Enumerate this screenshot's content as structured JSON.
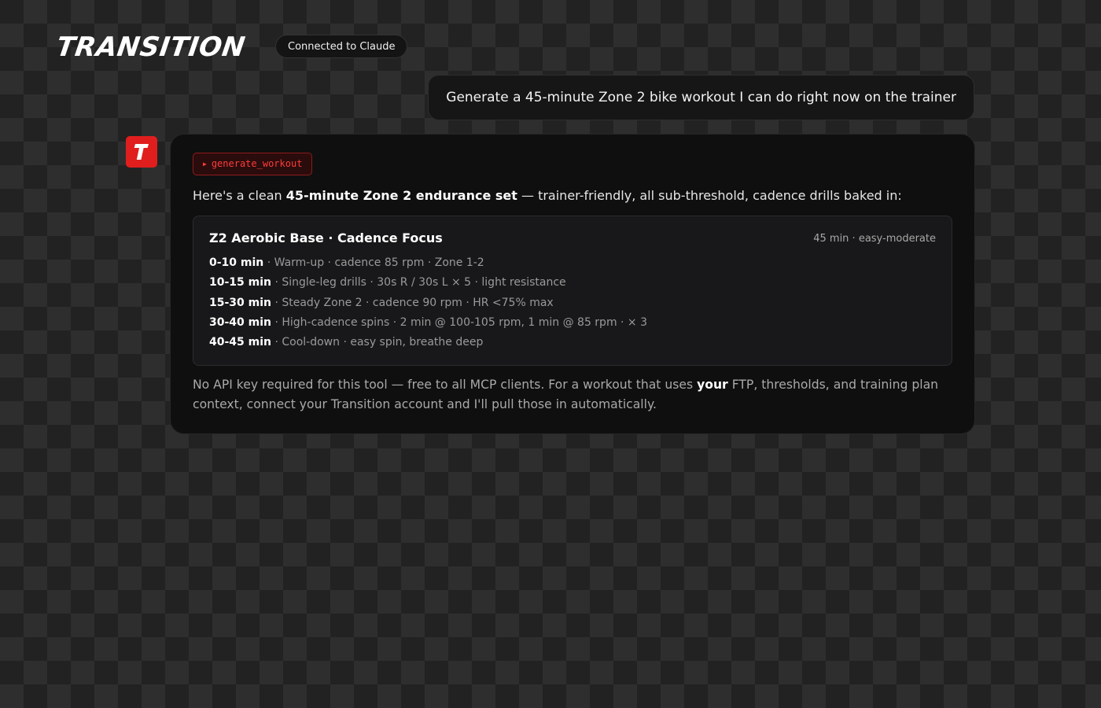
{
  "header": {
    "logo_text": "TRANSITION",
    "status": "Connected to Claude"
  },
  "user_message": {
    "text": "Generate a 45-minute Zone 2 bike workout I can do right now on the trainer"
  },
  "assistant": {
    "avatar_letter": "T",
    "tool_call": "generate_workout",
    "intro": {
      "before": "Here's a clean ",
      "bold": "45-minute Zone 2 endurance set",
      "after": " — trainer-friendly, all sub-threshold, cadence drills baked in:"
    },
    "workout": {
      "title": "Z2 Aerobic Base · Cadence Focus",
      "meta": "45 min · easy-moderate",
      "segments": [
        {
          "time": "0-10 min",
          "desc": " · Warm-up · cadence 85 rpm · Zone 1-2"
        },
        {
          "time": "10-15 min",
          "desc": " · Single-leg drills · 30s R / 30s L × 5 · light resistance"
        },
        {
          "time": "15-30 min",
          "desc": " · Steady Zone 2 · cadence 90 rpm · HR <75% max"
        },
        {
          "time": "30-40 min",
          "desc": " · High-cadence spins · 2 min @ 100-105 rpm, 1 min @ 85 rpm · × 3"
        },
        {
          "time": "40-45 min",
          "desc": " · Cool-down · easy spin, breathe deep"
        }
      ]
    },
    "outro": {
      "before": "No API key required for this tool — free to all MCP clients. For a workout that uses ",
      "bold": "your",
      "after": " FTP, thresholds, and training plan context, connect your Transition account and I'll pull those in automatically."
    }
  },
  "colors": {
    "accent": "#e01e1e",
    "tool_chip_text": "#ff3b3b",
    "background_dark": "#222222",
    "background_light": "#2e2e2e",
    "card_bg": "#0f0f10"
  },
  "icons": {
    "avatar": "transition-logo-icon",
    "tool_caret": "caret-right-icon"
  }
}
